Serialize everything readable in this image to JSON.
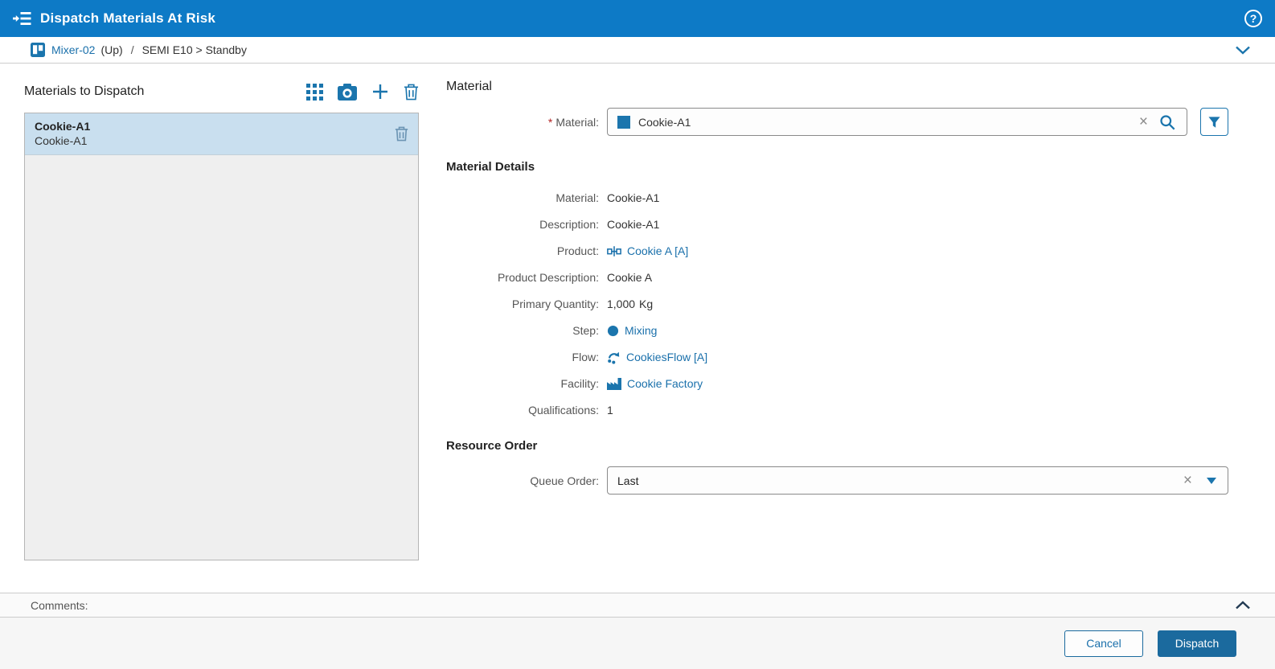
{
  "title_bar": {
    "icon": "dispatch-list-icon",
    "title": "Dispatch Materials At Risk",
    "help_icon": "help-icon",
    "help_glyph": "?"
  },
  "breadcrumb": {
    "resource_icon": "resource-icon",
    "resource_link": "Mixer-02",
    "resource_state": "(Up)",
    "separator": "/",
    "status_text": "SEMI E10 > Standby",
    "collapse_icon": "chevron-down-icon"
  },
  "materials_panel": {
    "title": "Materials to Dispatch",
    "toolbar": [
      {
        "name": "grid-view-icon"
      },
      {
        "name": "camera-icon"
      },
      {
        "name": "add-icon"
      },
      {
        "name": "delete-icon"
      }
    ],
    "items": [
      {
        "name": "Cookie-A1",
        "description": "Cookie-A1",
        "selected": true,
        "row_icon": "trash-icon"
      }
    ]
  },
  "material_section": {
    "heading": "Material",
    "required_marker": "*",
    "label": "Material:",
    "value": "Cookie-A1",
    "value_icon": "material-swatch-icon",
    "clear_glyph": "×",
    "search_icon": "search-icon",
    "filter_icon": "filter-icon"
  },
  "material_details": {
    "heading": "Material Details",
    "rows": [
      {
        "label": "Material:",
        "value": "Cookie-A1",
        "kind": "text"
      },
      {
        "label": "Description:",
        "value": "Cookie-A1",
        "kind": "text"
      },
      {
        "label": "Product:",
        "value": "Cookie A [A]",
        "kind": "link",
        "icon": "product-icon"
      },
      {
        "label": "Product Description:",
        "value": "Cookie A",
        "kind": "text"
      },
      {
        "label": "Primary Quantity:",
        "value": "1,000",
        "unit": "Kg",
        "kind": "text"
      },
      {
        "label": "Step:",
        "value": "Mixing",
        "kind": "link",
        "icon": "step-icon"
      },
      {
        "label": "Flow:",
        "value": "CookiesFlow [A]",
        "kind": "link",
        "icon": "flow-icon"
      },
      {
        "label": "Facility:",
        "value": "Cookie Factory",
        "kind": "link",
        "icon": "facility-icon"
      },
      {
        "label": "Qualifications:",
        "value": "1",
        "kind": "text"
      }
    ]
  },
  "resource_order": {
    "heading": "Resource Order",
    "label": "Queue Order:",
    "value": "Last",
    "clear_glyph": "×",
    "dropdown_icon": "caret-down-icon"
  },
  "comments_bar": {
    "label": "Comments:",
    "collapse_icon": "chevron-up-icon"
  },
  "footer": {
    "cancel_label": "Cancel",
    "dispatch_label": "Dispatch"
  },
  "colors": {
    "header_blue": "#0d7ac6",
    "icon_blue": "#1b75ad",
    "link_blue": "#1a70ab",
    "dispatch_button_blue": "#1b6a9e",
    "selected_row_bg": "#c9dfef",
    "panel_bg": "#efefef",
    "required_red": "#b22222"
  }
}
